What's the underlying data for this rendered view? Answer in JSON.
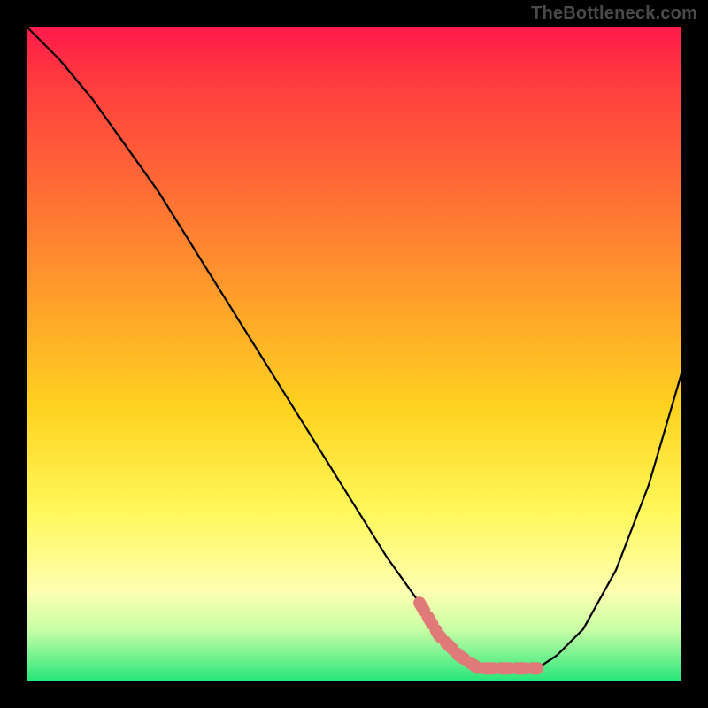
{
  "watermark": "TheBottleneck.com",
  "chart_data": {
    "type": "line",
    "title": "",
    "xlabel": "",
    "ylabel": "",
    "xlim": [
      0,
      100
    ],
    "ylim": [
      0,
      100
    ],
    "series": [
      {
        "name": "curve",
        "x": [
          0,
          5,
          10,
          15,
          20,
          25,
          30,
          35,
          40,
          45,
          50,
          55,
          60,
          63,
          66,
          69,
          72,
          75,
          78,
          81,
          85,
          90,
          95,
          100
        ],
        "values": [
          100,
          95,
          89,
          82,
          75,
          67,
          59,
          51,
          43,
          35,
          27,
          19,
          12,
          7,
          4,
          2,
          2,
          2,
          2,
          4,
          8,
          17,
          30,
          47
        ]
      }
    ],
    "highlight_range_x": [
      58,
      80
    ],
    "colors": {
      "curve": "#000000",
      "highlight": "#e07a78"
    }
  }
}
